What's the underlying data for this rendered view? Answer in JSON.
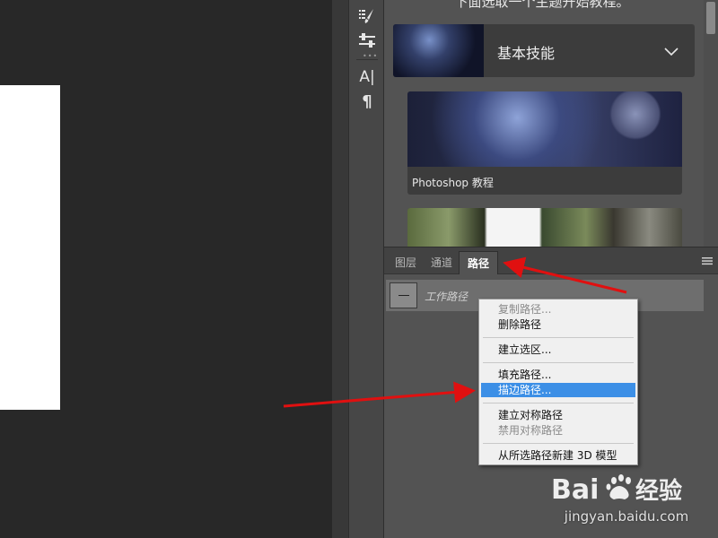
{
  "tools": {
    "type_tool_glyph": "A|",
    "paragraph_glyph": "¶",
    "icons": [
      "brush-list-icon",
      "sliders-icon",
      "type-tool-icon",
      "paragraph-icon"
    ]
  },
  "learn_panel": {
    "heading": "下面选取一个主题开始教程。",
    "category_title": "基本技能",
    "tutorials": [
      {
        "caption": "Photoshop 教程"
      },
      {
        "caption": ""
      }
    ]
  },
  "paths_panel": {
    "tabs": [
      {
        "label": "图层",
        "active": false
      },
      {
        "label": "通道",
        "active": false
      },
      {
        "label": "路径",
        "active": true
      }
    ],
    "work_path_name": "工作路径"
  },
  "context_menu": {
    "items": [
      {
        "label": "复制路径...",
        "enabled": false,
        "highlighted": false
      },
      {
        "label": "删除路径",
        "enabled": true,
        "highlighted": false
      },
      {
        "label": "建立选区...",
        "enabled": true,
        "highlighted": false
      },
      {
        "label": "填充路径...",
        "enabled": true,
        "highlighted": false
      },
      {
        "label": "描边路径...",
        "enabled": true,
        "highlighted": true
      },
      {
        "label": "建立对称路径",
        "enabled": true,
        "highlighted": false
      },
      {
        "label": "禁用对称路径",
        "enabled": false,
        "highlighted": false
      },
      {
        "label": "从所选路径新建 3D 模型",
        "enabled": true,
        "highlighted": false
      }
    ]
  },
  "watermark": {
    "logo_text": "Bai du 经验",
    "url": "jingyan.baidu.com"
  },
  "colors": {
    "canvas_bg": "#282828",
    "panel_bg": "#535353",
    "menu_highlight": "#3c8fe6",
    "annotation_red": "#e01010"
  }
}
